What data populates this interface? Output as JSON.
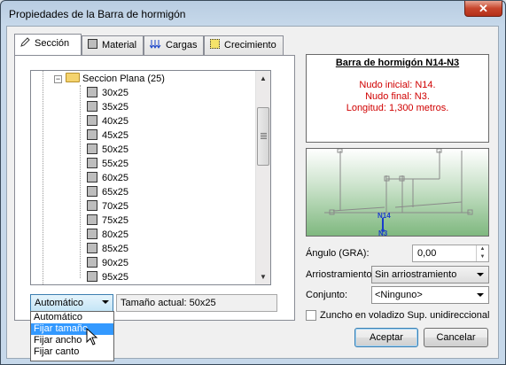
{
  "window": {
    "title": "Propiedades de la Barra de hormigón",
    "close": "✕"
  },
  "tabs": [
    {
      "label": "Sección",
      "icon": "pencil-icon"
    },
    {
      "label": "Material",
      "icon": "material-square-icon"
    },
    {
      "label": "Cargas",
      "icon": "loads-arrows-icon"
    },
    {
      "label": "Crecimiento",
      "icon": "growth-dotted-square-icon"
    }
  ],
  "tree": {
    "folder": "Seccion Plana (25)",
    "items": [
      "30x25",
      "35x25",
      "40x25",
      "45x25",
      "50x25",
      "55x25",
      "60x25",
      "65x25",
      "70x25",
      "75x25",
      "80x25",
      "85x25",
      "90x25",
      "95x25"
    ]
  },
  "size_mode": {
    "selected": "Automático",
    "current_size": "Tamaño actual: 50x25",
    "options": [
      "Automático",
      "Fijar tamaño",
      "Fijar ancho",
      "Fijar canto"
    ],
    "highlighted": "Fijar tamaño"
  },
  "info": {
    "title": "Barra de hormigón N14-N3",
    "lines": [
      "Nudo inicial: N14.",
      "Nudo final: N3.",
      "Longitud: 1,300 metros."
    ]
  },
  "view": {
    "node_a": "N14",
    "node_b": "N3"
  },
  "form": {
    "angle_label": "Ángulo (GRA):",
    "angle_value": "0,00",
    "bracing_label": "Arriostramiento:",
    "bracing_value": "Sin arriostramiento",
    "set_label": "Conjunto:",
    "set_value": "<Ninguno>",
    "checkbox_label": "Zuncho en voladizo Sup. unidireccional"
  },
  "buttons": {
    "accept": "Aceptar",
    "cancel": "Cancelar"
  },
  "colors": {
    "info_text": "#d00000",
    "selection": "#3399ff"
  }
}
